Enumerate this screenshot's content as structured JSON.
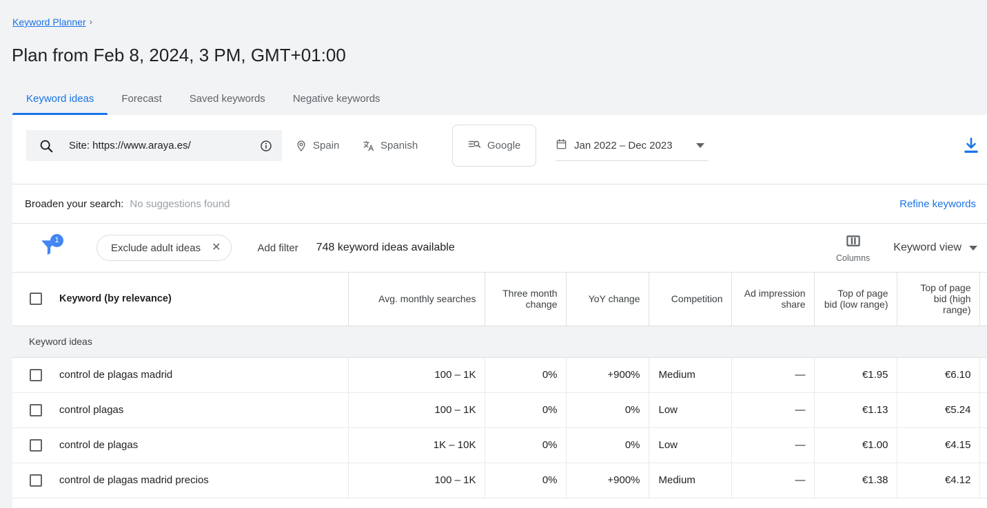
{
  "breadcrumb": {
    "label": "Keyword Planner",
    "separator": "›"
  },
  "header": {
    "title": "Plan from Feb 8, 2024, 3 PM, GMT+01:00"
  },
  "tabs": [
    {
      "label": "Keyword ideas",
      "active": true
    },
    {
      "label": "Forecast",
      "active": false
    },
    {
      "label": "Saved keywords",
      "active": false
    },
    {
      "label": "Negative keywords",
      "active": false
    }
  ],
  "toolbar": {
    "search_value": "Site: https://www.araya.es/",
    "search_placeholder": "Enter a site",
    "search_icon": "search-icon",
    "info_icon": "info-icon",
    "location": {
      "label": "Spain",
      "icon": "location-pin-icon"
    },
    "language": {
      "label": "Spanish",
      "icon": "translate-icon"
    },
    "network": {
      "label": "Google",
      "icon": "search-network-icon"
    },
    "date_range": {
      "label": "Jan 2022 – Dec 2023",
      "icon": "calendar-icon",
      "arrow": "chevron-down-icon"
    },
    "download": {
      "icon": "download-icon",
      "color": "#1a73e8"
    }
  },
  "broaden": {
    "label": "Broaden your search:",
    "value": "No suggestions found",
    "refine_label": "Refine keywords"
  },
  "filters": {
    "filter_icon": "filter-icon",
    "badge_count": "1",
    "chips": [
      {
        "label": "Exclude adult ideas",
        "remove_icon": "close-icon"
      }
    ],
    "add_filter_label": "Add filter",
    "available_count_label": "748 keyword ideas available",
    "columns_label": "Columns",
    "columns_icon": "columns-icon",
    "view_label": "Keyword view",
    "view_arrow": "chevron-down-icon"
  },
  "table": {
    "group_label": "Keyword ideas",
    "columns": [
      "Keyword (by relevance)",
      "Avg. monthly searches",
      "Three month change",
      "YoY change",
      "Competition",
      "Ad impression share",
      "Top of page bid (low range)",
      "Top of page bid (high range)"
    ],
    "rows": [
      {
        "keyword": "control de plagas madrid",
        "avg_monthly_searches": "100 – 1K",
        "three_month_change": "0%",
        "yoy_change": "+900%",
        "competition": "Medium",
        "ad_impression_share": "—",
        "bid_low": "€1.95",
        "bid_high": "€6.10"
      },
      {
        "keyword": "control plagas",
        "avg_monthly_searches": "100 – 1K",
        "three_month_change": "0%",
        "yoy_change": "0%",
        "competition": "Low",
        "ad_impression_share": "—",
        "bid_low": "€1.13",
        "bid_high": "€5.24"
      },
      {
        "keyword": "control de plagas",
        "avg_monthly_searches": "1K – 10K",
        "three_month_change": "0%",
        "yoy_change": "0%",
        "competition": "Low",
        "ad_impression_share": "—",
        "bid_low": "€1.00",
        "bid_high": "€4.15"
      },
      {
        "keyword": "control de plagas madrid precios",
        "avg_monthly_searches": "100 – 1K",
        "three_month_change": "0%",
        "yoy_change": "+900%",
        "competition": "Medium",
        "ad_impression_share": "—",
        "bid_low": "€1.38",
        "bid_high": "€4.12"
      }
    ]
  },
  "colors": {
    "accent": "#1a73e8",
    "badge": "#4285f4",
    "page_bg": "#f1f3f4",
    "text_primary": "#202124",
    "text_secondary": "#5f6368"
  }
}
